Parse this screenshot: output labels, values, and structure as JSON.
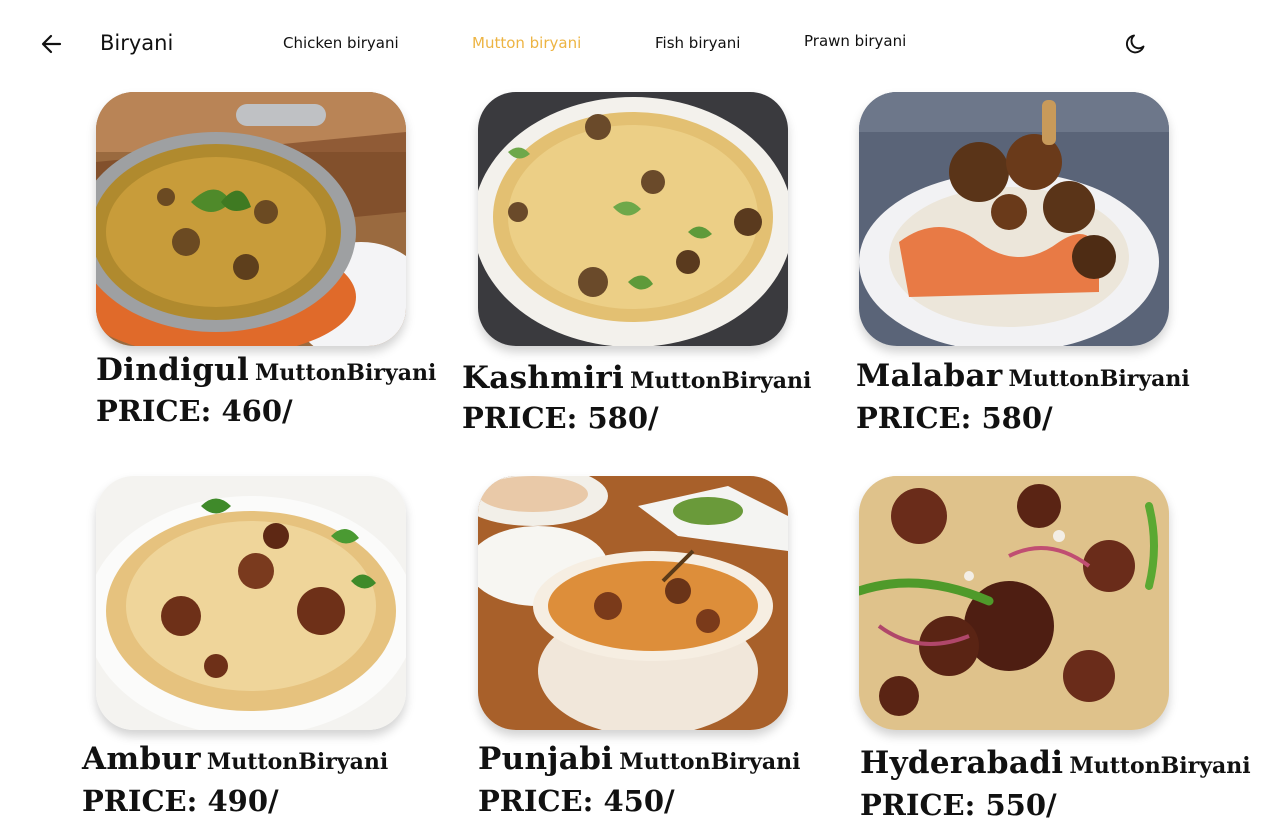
{
  "header": {
    "title": "Biryani",
    "back_icon": "arrow-left-icon",
    "theme_icon": "moon-icon",
    "accent_color": "#EDB443",
    "tabs": [
      {
        "label": "Chicken biryani",
        "active": false
      },
      {
        "label": "Mutton biryani",
        "active": true
      },
      {
        "label": "Fish biryani",
        "active": false
      },
      {
        "label": "Prawn biryani",
        "active": false
      }
    ]
  },
  "items": [
    {
      "place": "Dindigul",
      "kind": "MuttonBiryani",
      "price": "PRICE: 460/"
    },
    {
      "place": "Kashmiri",
      "kind": "MuttonBiryani",
      "price": "PRICE: 580/"
    },
    {
      "place": "Malabar",
      "kind": "MuttonBiryani",
      "price": "PRICE: 580/"
    },
    {
      "place": "Ambur",
      "kind": "MuttonBiryani",
      "price": "PRICE: 490/"
    },
    {
      "place": "Punjabi",
      "kind": "MuttonBiryani",
      "price": "PRICE: 450/"
    },
    {
      "place": "Hyderabadi",
      "kind": "MuttonBiryani",
      "price": "PRICE: 550/"
    }
  ]
}
